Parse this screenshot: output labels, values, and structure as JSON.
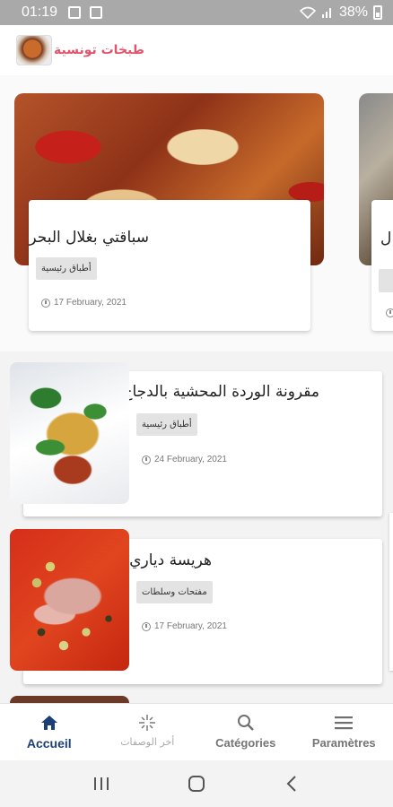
{
  "status_bar": {
    "time": "01:19",
    "battery": "38%"
  },
  "header": {
    "title": "طبخات تونسية",
    "logo_icon": "app-logo-dish"
  },
  "featured": [
    {
      "title": "سباقتي بغلال البحر",
      "tag": "أطباق رئيسية",
      "date": "17 February, 2021"
    },
    {
      "title": "ل"
    }
  ],
  "recipes": [
    {
      "title": "مقرونة الوردة المحشية بالدجاج",
      "tag": "أطباق رئيسية",
      "date": "24 February, 2021"
    },
    {
      "title": "هريسة دياري",
      "tag": "مفتحات وسلطات",
      "date": "17 February, 2021"
    }
  ],
  "bottom_nav": {
    "home": "Accueil",
    "latest": "أخر الوصفات",
    "categories": "Catégories",
    "settings": "Paramètres"
  },
  "colors": {
    "accent": "#1c3f78",
    "title_pink": "#e0546d",
    "status_bar": "#a9a9a9"
  },
  "icons": [
    "wifi-icon",
    "signal-icon",
    "battery-icon",
    "home-icon",
    "sparkle-icon",
    "search-icon",
    "menu-icon",
    "clock-icon"
  ]
}
